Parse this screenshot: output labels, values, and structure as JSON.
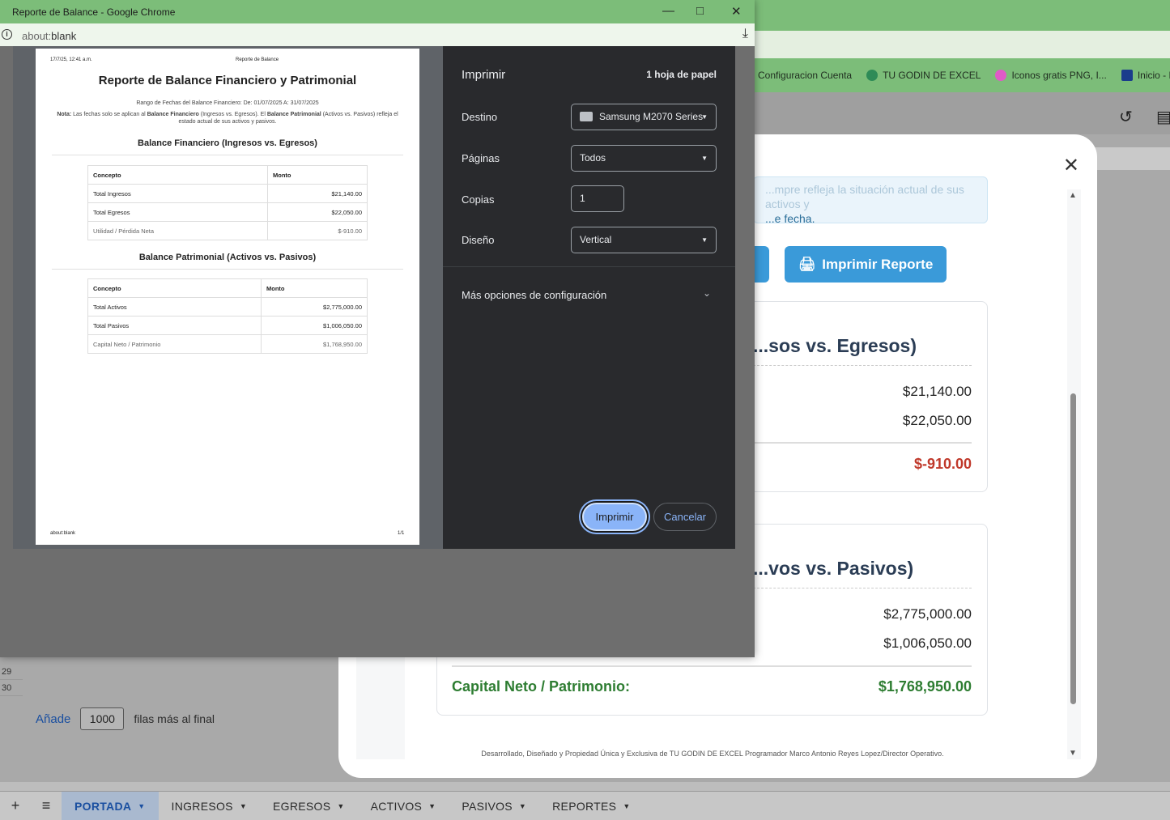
{
  "chrome": {
    "window_title": "Reporte de Balance - Google Chrome",
    "url_scheme": "about:",
    "url_path": "blank"
  },
  "bookmarks": [
    {
      "label": "Configuracion Cuenta",
      "icon": "none"
    },
    {
      "label": "TU GODIN DE EXCEL",
      "icon": "circle-logo-icon"
    },
    {
      "label": "Iconos gratis PNG, I...",
      "icon": "colorful-logo-icon"
    },
    {
      "label": "Inicio - PayPal",
      "icon": "paypal-icon"
    }
  ],
  "print_preview": {
    "header_date": "17/7/25, 12:41 a.m.",
    "header_title": "Reporte de Balance",
    "title": "Reporte de Balance Financiero y Patrimonial",
    "range": "Rango de Fechas del Balance Financiero: De: 01/07/2025 A: 31/07/2025",
    "note_label": "Nota:",
    "note_text_1": " Las fechas solo se aplican al ",
    "note_bold_1": "Balance Financiero",
    "note_text_2": " (Ingresos vs. Egresos). El ",
    "note_bold_2": "Balance Patrimonial",
    "note_text_3": " (Activos vs. Pasivos) refleja el estado actual de sus activos y pasivos.",
    "section1_title": "Balance Financiero (Ingresos vs. Egresos)",
    "section2_title": "Balance Patrimonial (Activos vs. Pasivos)",
    "table_headers": {
      "concept": "Concepto",
      "amount": "Monto"
    },
    "table1": [
      {
        "concept": "Total Ingresos",
        "amount": "$21,140.00"
      },
      {
        "concept": "Total Egresos",
        "amount": "$22,050.00"
      },
      {
        "concept": "Utilidad / Pérdida Neta",
        "amount": "$-910.00"
      }
    ],
    "table2": [
      {
        "concept": "Total Activos",
        "amount": "$2,775,000.00"
      },
      {
        "concept": "Total Pasivos",
        "amount": "$1,006,050.00"
      },
      {
        "concept": "Capital Neto / Patrimonio",
        "amount": "$1,768,950.00"
      }
    ],
    "footer_left": "about:blank",
    "footer_right": "1/1"
  },
  "print_settings": {
    "title": "Imprimir",
    "sheets": "1 hoja de papel",
    "destination_label": "Destino",
    "destination_value": "Samsung M2070 Series",
    "pages_label": "Páginas",
    "pages_value": "Todos",
    "copies_label": "Copias",
    "copies_value": "1",
    "layout_label": "Diseño",
    "layout_value": "Vertical",
    "more_options": "Más opciones de configuración",
    "print_button": "Imprimir",
    "cancel_button": "Cancelar"
  },
  "background_modal": {
    "info_line1": "...mpre refleja la situación actual de sus activos y",
    "info_line2": "...e fecha.",
    "print_report_button": "Imprimir Reporte",
    "card1_title": "...sos vs. Egresos)",
    "card1_values": [
      "$21,140.00",
      "$22,050.00"
    ],
    "card1_net": "$-910.00",
    "card2_title": "...vos vs. Pasivos)",
    "card2_values": [
      "$2,775,000.00",
      "$1,006,050.00"
    ],
    "card2_net_label": "Capital Neto / Patrimonio:",
    "card2_net": "$1,768,950.00",
    "footer_credit": "Desarrollado, Diseñado y Propiedad Única y Exclusiva de TU GODIN DE EXCEL Programador Marco Antonio Reyes Lopez/Director Operativo."
  },
  "sheet": {
    "row_numbers": [
      "29",
      "30"
    ],
    "add_link": "Añade",
    "add_count": "1000",
    "add_suffix": "filas más al final",
    "tabs": [
      {
        "label": "PORTADA",
        "active": true
      },
      {
        "label": "INGRESOS",
        "active": false
      },
      {
        "label": "EGRESOS",
        "active": false
      },
      {
        "label": "ACTIVOS",
        "active": false
      },
      {
        "label": "PASIVOS",
        "active": false
      },
      {
        "label": "REPORTES",
        "active": false
      }
    ]
  }
}
